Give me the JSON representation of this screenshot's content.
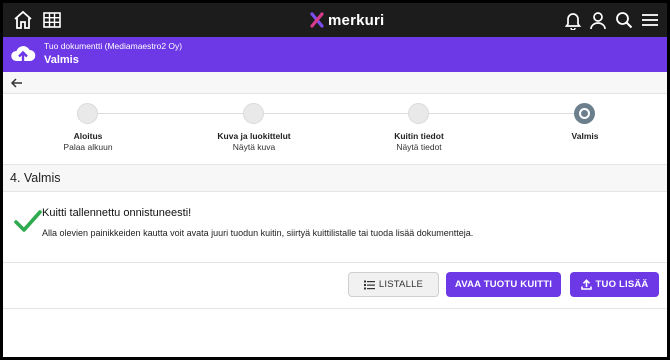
{
  "app": {
    "logo_text": "merkuri"
  },
  "header": {
    "subtitle": "Tuo dokumentti (Mediamaestro2 Oy)",
    "title": "Valmis"
  },
  "steps": [
    {
      "title": "Aloitus",
      "subtitle": "Palaa alkuun",
      "state": "pending"
    },
    {
      "title": "Kuva ja luokittelut",
      "subtitle": "Näytä kuva",
      "state": "pending"
    },
    {
      "title": "Kuitin tiedot",
      "subtitle": "Näytä tiedot",
      "state": "pending"
    },
    {
      "title": "Valmis",
      "subtitle": "",
      "state": "active"
    }
  ],
  "section": {
    "title": "4. Valmis"
  },
  "success": {
    "title": "Kuitti tallennettu onnistuneesti!",
    "text": "Alla olevien painikkeiden kautta voit avata juuri tuodun kuitin, siirtyä kuittilistalle tai tuoda lisää dokumentteja."
  },
  "actions": {
    "list_label": "LISTALLE",
    "open_label": "AVAA TUOTU KUITTI",
    "import_label": "TUO LISÄÄ"
  },
  "colors": {
    "accent": "#6d38e6",
    "topbar": "#1c1c1c",
    "success": "#2eaa4f"
  },
  "icons": [
    "home-icon",
    "grid-icon",
    "bell-icon",
    "user-icon",
    "search-icon",
    "menu-icon",
    "cloud-upload-icon",
    "back-arrow-icon",
    "check-icon",
    "list-icon",
    "upload-icon"
  ]
}
